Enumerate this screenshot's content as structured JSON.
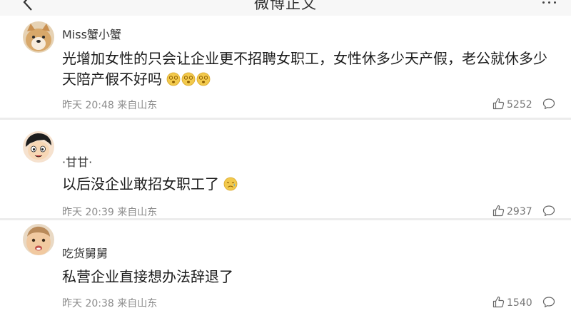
{
  "header": {
    "title": "微博正文"
  },
  "comments": [
    {
      "username": "Miss蟹小蟹",
      "text": "光增加女性的只会让企业更不招聘女职工，女性休多少天产假，老公就休多少天陪产假不好吗",
      "emojis": [
        "dizzy-face-emoji",
        "dizzy-face-emoji",
        "dizzy-face-emoji"
      ],
      "time": "昨天 20:48",
      "location": "来自山东",
      "likes": "5252"
    },
    {
      "username": "·甘甘·",
      "text": "以后没企业敢招女职工了",
      "emojis": [
        "sad-face-emoji"
      ],
      "time": "昨天 20:39",
      "location": "来自山东",
      "likes": "2937"
    },
    {
      "username": "吃货舅舅",
      "text": "私营企业直接想办法辞退了",
      "emojis": [],
      "time": "昨天 20:38",
      "location": "来自山东",
      "likes": "1540"
    }
  ],
  "colors": {
    "background": "#ececec",
    "card": "#ffffff",
    "meta": "#8c8c8c",
    "emoji": "#f2c94c"
  },
  "icons": [
    "back-arrow-icon",
    "more-icon",
    "thumbs-up-icon",
    "comment-bubble-icon"
  ]
}
